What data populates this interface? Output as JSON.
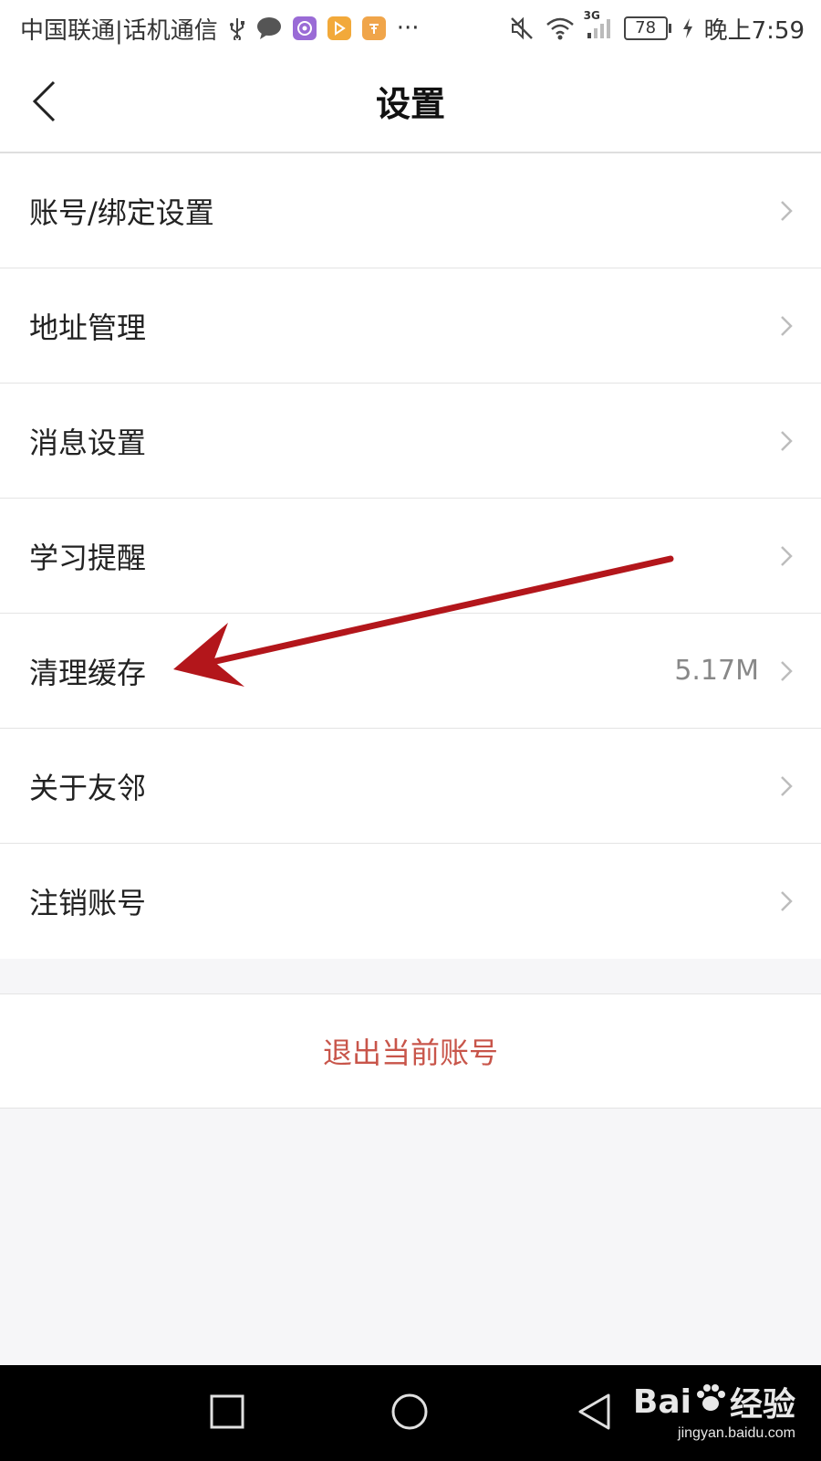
{
  "status_bar": {
    "carrier": "中国联通|话机通信",
    "network": "3G",
    "battery": "78",
    "time": "晚上7:59",
    "more": "···",
    "icons": [
      "usb-icon",
      "chat-bubble-icon",
      "app-purple-icon",
      "video-play-icon",
      "app-orange-icon",
      "mute-icon",
      "wifi-icon",
      "signal-icon",
      "charging-icon"
    ]
  },
  "header": {
    "title": "设置",
    "back_icon": "chevron-left-icon"
  },
  "settings": {
    "items": [
      {
        "label": "账号/绑定设置",
        "value": ""
      },
      {
        "label": "地址管理",
        "value": ""
      },
      {
        "label": "消息设置",
        "value": ""
      },
      {
        "label": "学习提醒",
        "value": ""
      },
      {
        "label": "清理缓存",
        "value": "5.17M"
      },
      {
        "label": "关于友邻",
        "value": ""
      },
      {
        "label": "注销账号",
        "value": ""
      }
    ]
  },
  "logout": {
    "label": "退出当前账号"
  },
  "watermark": {
    "brand": "Bai",
    "brand_suffix": "经验",
    "url": "jingyan.baidu.com"
  },
  "colors": {
    "accent_logout": "#c8554a",
    "annotation_arrow": "#b3161b",
    "background": "#f6f6f8"
  }
}
